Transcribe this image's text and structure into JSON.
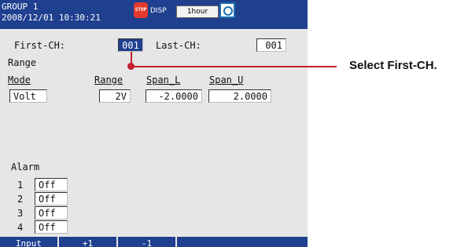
{
  "status_bar": {
    "group": "GROUP 1",
    "datetime": "2008/12/01 10:30:21",
    "stop_icon_text": "STOP",
    "disp_label": "DISP",
    "interval": "1hour"
  },
  "channel": {
    "first_label": "First-CH:",
    "first_value": "001",
    "last_label": "Last-CH:",
    "last_value": "001"
  },
  "range": {
    "section_label": "Range",
    "mode_label": "Mode",
    "mode_value": "Volt",
    "range_label": "Range",
    "range_value": "2V",
    "span_l_label": "Span_L",
    "span_l_value": "-2.0000",
    "span_u_label": "Span_U",
    "span_u_value": "2.0000"
  },
  "alarm": {
    "section_label": "Alarm",
    "rows": [
      {
        "num": "1",
        "value": "Off"
      },
      {
        "num": "2",
        "value": "Off"
      },
      {
        "num": "3",
        "value": "Off"
      },
      {
        "num": "4",
        "value": "Off"
      }
    ]
  },
  "softkeys": [
    "Input",
    "+1",
    "-1"
  ],
  "callout": "Select First-CH.",
  "colors": {
    "accent": "#1f3f8f",
    "callout": "#c41f2e",
    "screen_bg": "#e6e6e6"
  },
  "icons": [
    "stop-icon",
    "camera-icon"
  ]
}
